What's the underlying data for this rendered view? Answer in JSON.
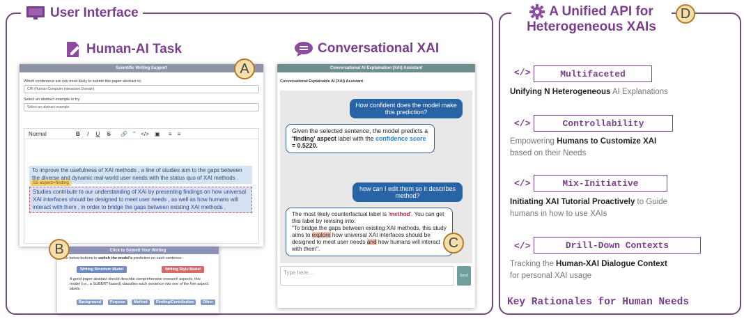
{
  "ui_section": {
    "title": "User Interface",
    "human_ai_task": {
      "title": "Human-AI Task",
      "marker": "A",
      "header": "Scientific Writing Support",
      "q_conference": "Which conference are you most likely to submit this paper abstract to:",
      "conf_value": "CHI (Human-Computer Interaction Domain)",
      "q_example": "Select an abstract example to try:",
      "example_value": "Select an abstract example",
      "toolbar_text": "Normal",
      "paragraph1": "To improve the usefulness of XAI methods , a line of studies aim to the gaps between the diverse and dynamic real-world user needs with the status quo of XAI methods .",
      "aspect_tag": "S3 aspect=finding",
      "paragraph2": "Studies contribute to our understanding of XAI by presenting findings on how universal XAI interfaces should be designed to meet user needs , as well as how humans will interact with them , in order to bridge the gaps between existing XAI methods ."
    },
    "submit_panel": {
      "marker": "B",
      "header": "Click to Submit Your Writing",
      "instruction_pre": "Click below buttons to ",
      "instruction_bold": "switch the model's",
      "instruction_post": " prediction on each sentence.",
      "btn_structure": "Writing Structure Model",
      "btn_style": "Writing Style Model",
      "description": "A good paper abstract should describe comprehensive research aspects, this model (i.e., a SciBERT-based) classifies each sentence into one of the five aspect labels.",
      "labels": [
        "Background",
        "Purpose",
        "Method",
        "Finding/Contribution",
        "Other"
      ]
    },
    "conversational": {
      "title": "Conversational XAI",
      "marker": "C",
      "header": "Conversational AI Explaination (XAI) Assistant",
      "sub_header": "Conversational Explainable AI (XAI) Assistant",
      "user_q1": "How confident does the model make this prediction?",
      "bot_a1_pre": "Given the selected sentence, the model predicts a ",
      "bot_a1_label": "'finding' aspect",
      "bot_a1_mid": " label with the ",
      "bot_a1_conf": "confidence score",
      "bot_a1_value": "= 0.5220.",
      "user_q2": "how can I edit them so it describes method?",
      "bot_a2_pre": "The most likely counterfactual label is '",
      "bot_a2_label": "method",
      "bot_a2_mid": "'. You can get this label by revising into:",
      "bot_a2_quote_1": "\"To bridge the gaps between existing XAI methods, this study aims to ",
      "bot_a2_quote_hl": "explore",
      "bot_a2_quote_2": " how universal XAI interfaces should be designed to meet user needs ",
      "bot_a2_quote_and": "and",
      "bot_a2_quote_3": " how humans will interact with them\".",
      "input_placeholder": "Type here...",
      "send_label": "Send"
    }
  },
  "api_section": {
    "title_line1": "A Unified API for",
    "title_line2": "Heterogeneous XAIs",
    "marker": "D",
    "code_symbol": "</>",
    "items": [
      {
        "keyword": "Multifaceted",
        "desc_bold1": "Unifying N Heterogeneous",
        "desc_rest": " AI Explanations"
      },
      {
        "keyword": "Controllability",
        "desc_pre": "Empowering ",
        "desc_bold1": "Humans to Customize XAI",
        "desc_rest": "based on their Needs"
      },
      {
        "keyword": "Mix-Initiative",
        "desc_bold1": "Initiating XAI Tutorial Proactively",
        "desc_rest": " to Guide",
        "desc_line2": "humans in how to use XAIs"
      },
      {
        "keyword": "Drill-Down Contexts",
        "desc_pre": "Tracking the ",
        "desc_bold1": "Human-XAI Dialogue Context",
        "desc_rest": "for personal XAI usage"
      }
    ],
    "footer": "Key Rationales for Human Needs"
  },
  "colors": {
    "accent": "#7a3e8e",
    "marker_fill": "#f6dfa8",
    "chat_blue": "#2863a5",
    "header_teal": "#6f8e8e"
  }
}
